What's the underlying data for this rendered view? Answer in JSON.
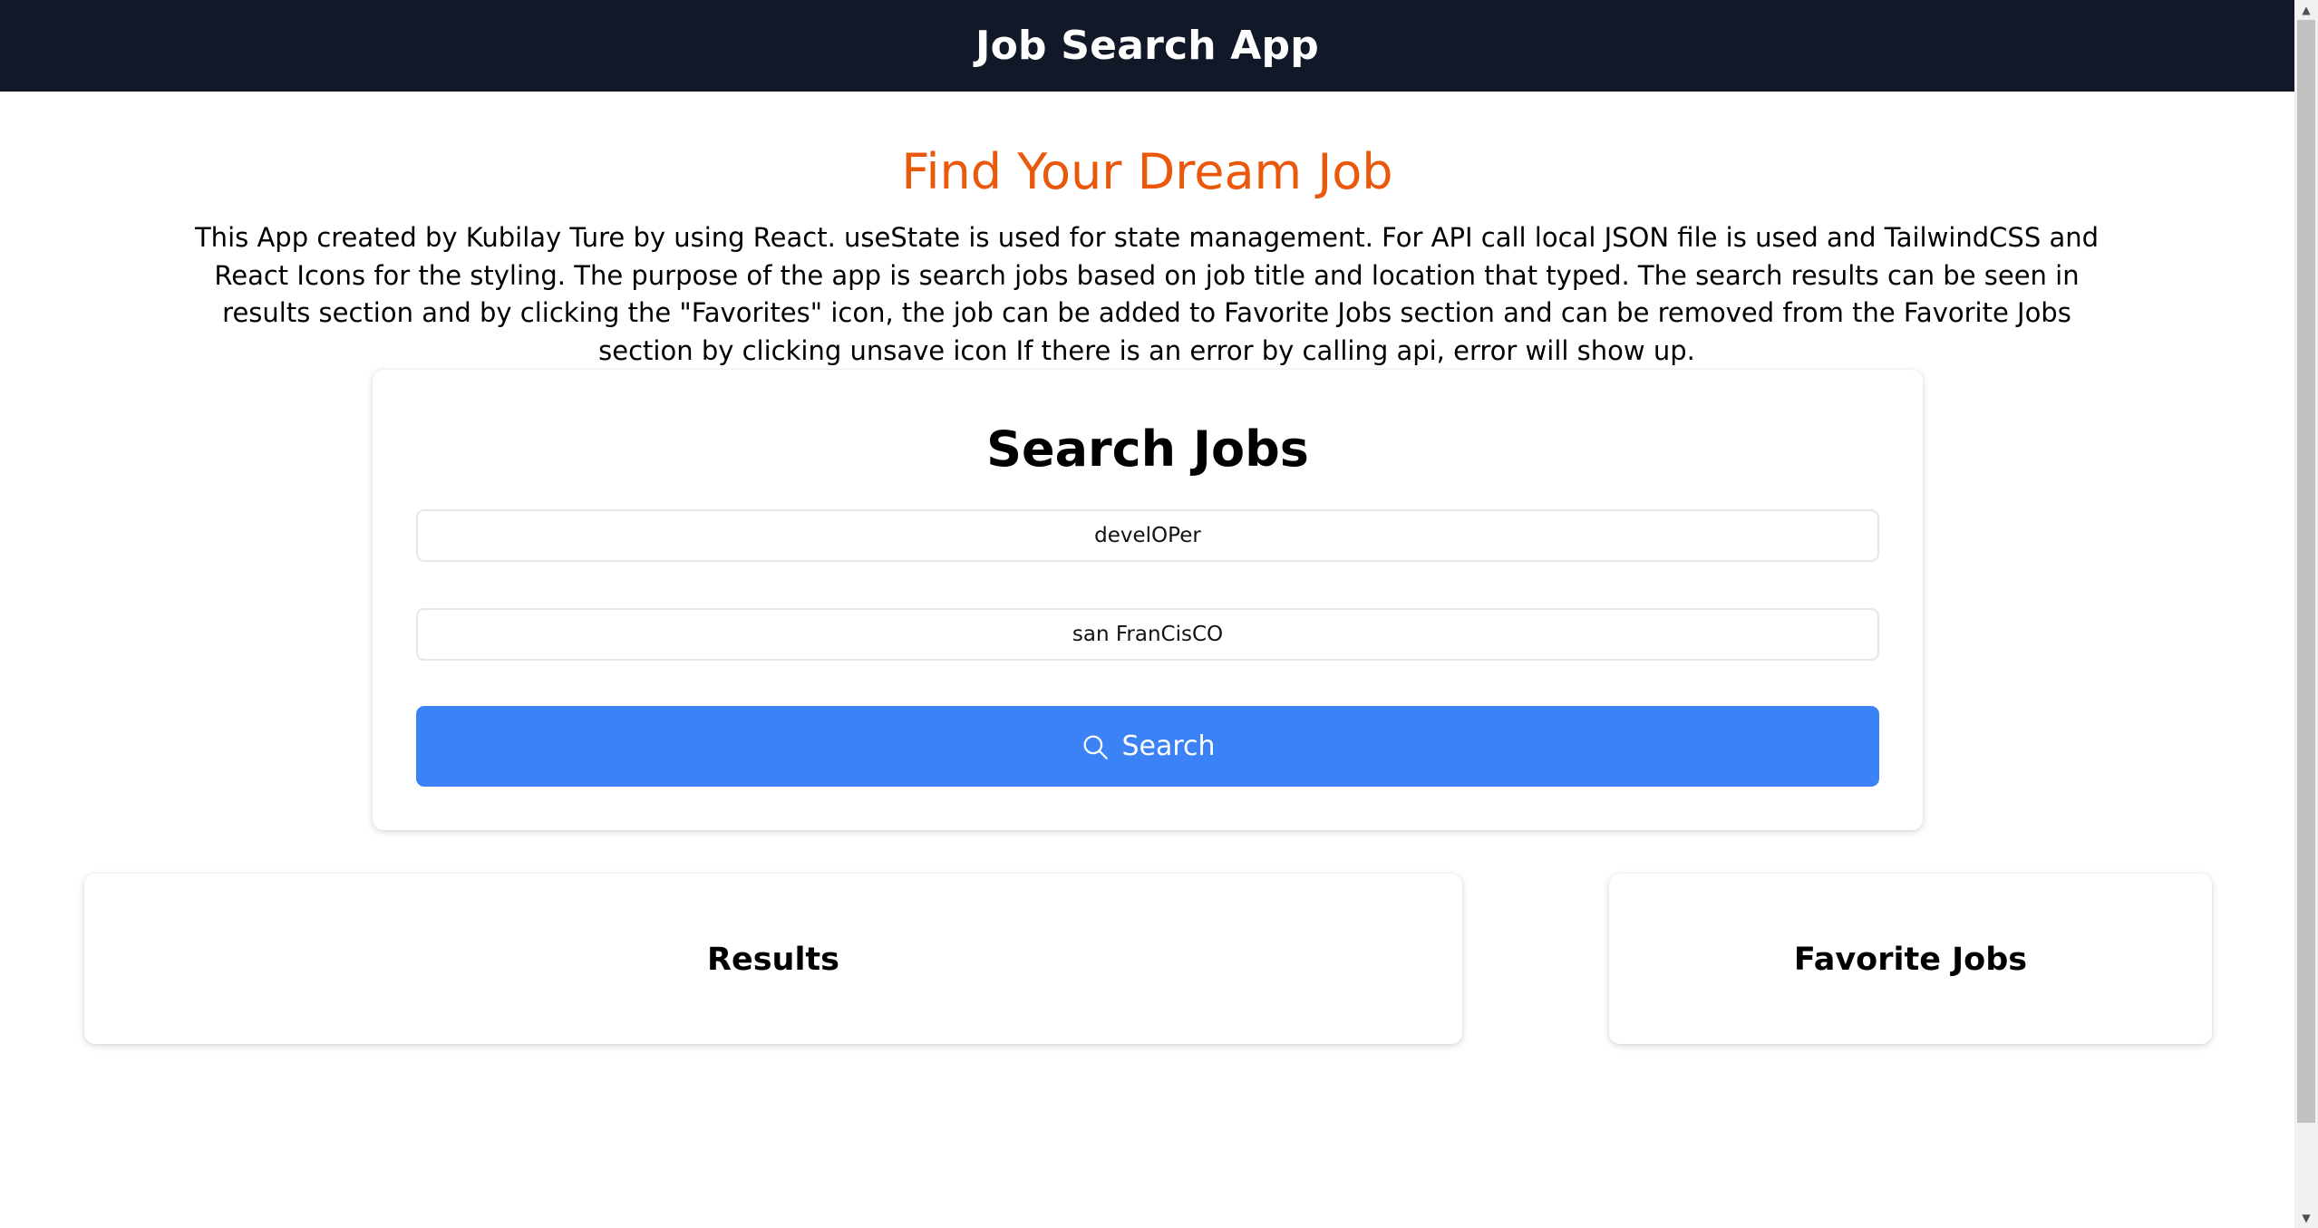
{
  "header": {
    "title": "Job Search App"
  },
  "hero": {
    "title": "Find Your Dream Job",
    "description": "This App created by Kubilay Ture by using React. useState is used for state management. For API call local JSON file is used and TailwindCSS and React Icons for the styling. The purpose of the app is search jobs based on job title and location that typed. The search results can be seen in results section and by clicking the \"Favorites\" icon, the job can be added to Favorite Jobs section and can be removed from the Favorite Jobs section by clicking unsave icon If there is an error by calling api, error will show up."
  },
  "search": {
    "title": "Search Jobs",
    "job_title_value": "develOPer",
    "location_value": "san FranCisCO",
    "button_label": "Search",
    "button_icon": "search-icon"
  },
  "results": {
    "title": "Results"
  },
  "favorites": {
    "title": "Favorite Jobs"
  },
  "colors": {
    "navbar_bg": "#111827",
    "accent": "#ea580c",
    "button_bg": "#3b82f6"
  }
}
